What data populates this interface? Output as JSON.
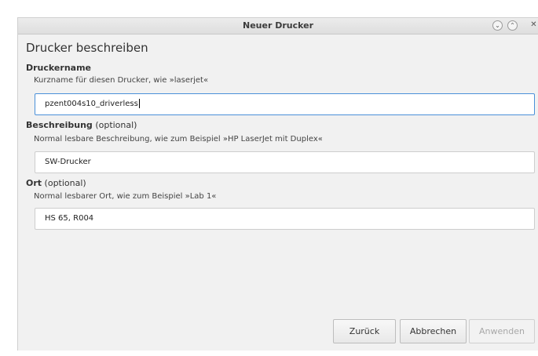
{
  "window": {
    "title": "Neuer Drucker"
  },
  "heading": "Drucker beschreiben",
  "fields": {
    "name": {
      "label": "Druckername",
      "hint": "Kurzname für diesen Drucker, wie »laserjet«",
      "value": "pzent004s10_driverless"
    },
    "description": {
      "label": "Beschreibung",
      "optional": "(optional)",
      "hint": "Normal lesbare Beschreibung, wie zum Beispiel »HP LaserJet mit Duplex«",
      "value": "SW-Drucker"
    },
    "location": {
      "label": "Ort",
      "optional": "(optional)",
      "hint": "Normal lesbarer Ort, wie zum Beispiel »Lab 1«",
      "value": "HS 65, R004"
    }
  },
  "buttons": {
    "back": "Zurück",
    "cancel": "Abbrechen",
    "apply": "Anwenden"
  },
  "icons": {
    "minimize": "chevron-down-icon",
    "maximize": "chevron-up-icon",
    "close": "close-icon"
  }
}
